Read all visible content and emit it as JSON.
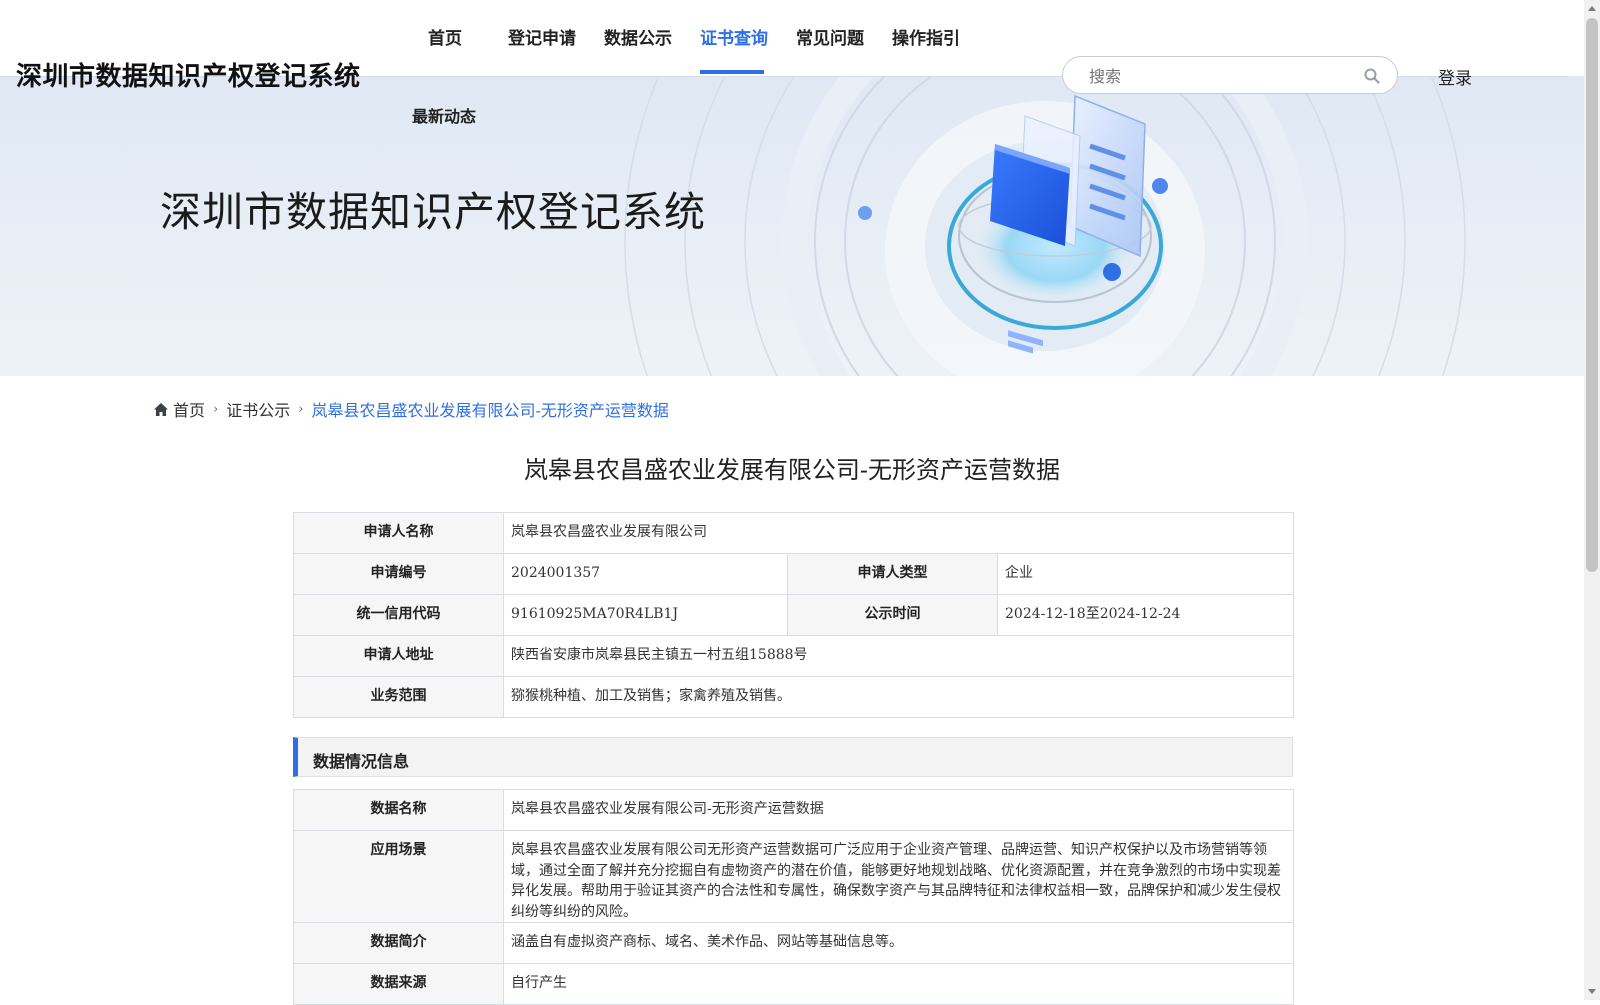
{
  "header": {
    "site_title": "深圳市数据知识产权登记系统",
    "nav": [
      {
        "label": "首页",
        "active": false
      },
      {
        "label": "登记申请",
        "active": false
      },
      {
        "label": "数据公示",
        "active": false
      },
      {
        "label": "证书查询",
        "active": true
      },
      {
        "label": "常见问题",
        "active": false
      },
      {
        "label": "操作指引",
        "active": false
      }
    ],
    "nav_more": "最新动态",
    "search": {
      "placeholder": "搜索",
      "value": ""
    },
    "login_label": "登录",
    "accent_color": "#2f6fe4"
  },
  "banner": {
    "title": "深圳市数据知识产权登记系统"
  },
  "breadcrumb": {
    "home": "首页",
    "section": "证书公示",
    "current": "岚皋县农昌盛农业发展有限公司-无形资产运营数据"
  },
  "page_title": "岚皋县农昌盛农业发展有限公司-无形资产运营数据",
  "applicant": {
    "name_label": "申请人名称",
    "name": "岚皋县农昌盛农业发展有限公司",
    "number_label": "申请编号",
    "number": "2024001357",
    "type_label": "申请人类型",
    "type": "企业",
    "credit_code_label": "统一信用代码",
    "credit_code": "91610925MA70R4LB1J",
    "publicity_label": "公示时间",
    "publicity": "2024-12-18至2024-12-24",
    "address_label": "申请人地址",
    "address": "陕西省安康市岚皋县民主镇五一村五组15888号",
    "scope_label": "业务范围",
    "scope": "猕猴桃种植、加工及销售；家禽养殖及销售。"
  },
  "data_section": {
    "title": "数据情况信息",
    "rows": [
      {
        "label": "数据名称",
        "value": "岚皋县农昌盛农业发展有限公司-无形资产运营数据"
      },
      {
        "label": "应用场景",
        "value": "岚皋县农昌盛农业发展有限公司无形资产运营数据可广泛应用于企业资产管理、品牌运营、知识产权保护以及市场营销等领域，通过全面了解并充分挖掘自有虚物资产的潜在价值，能够更好地规划战略、优化资源配置，并在竞争激烈的市场中实现差异化发展。帮助用于验证其资产的合法性和专属性，确保数字资产与其品牌特征和法律权益相一致，品牌保护和减少发生侵权纠纷等纠纷的风险。"
      },
      {
        "label": "数据简介",
        "value": "涵盖自有虚拟资产商标、域名、美术作品、网站等基础信息等。"
      },
      {
        "label": "数据来源",
        "value": "自行产生"
      }
    ]
  }
}
